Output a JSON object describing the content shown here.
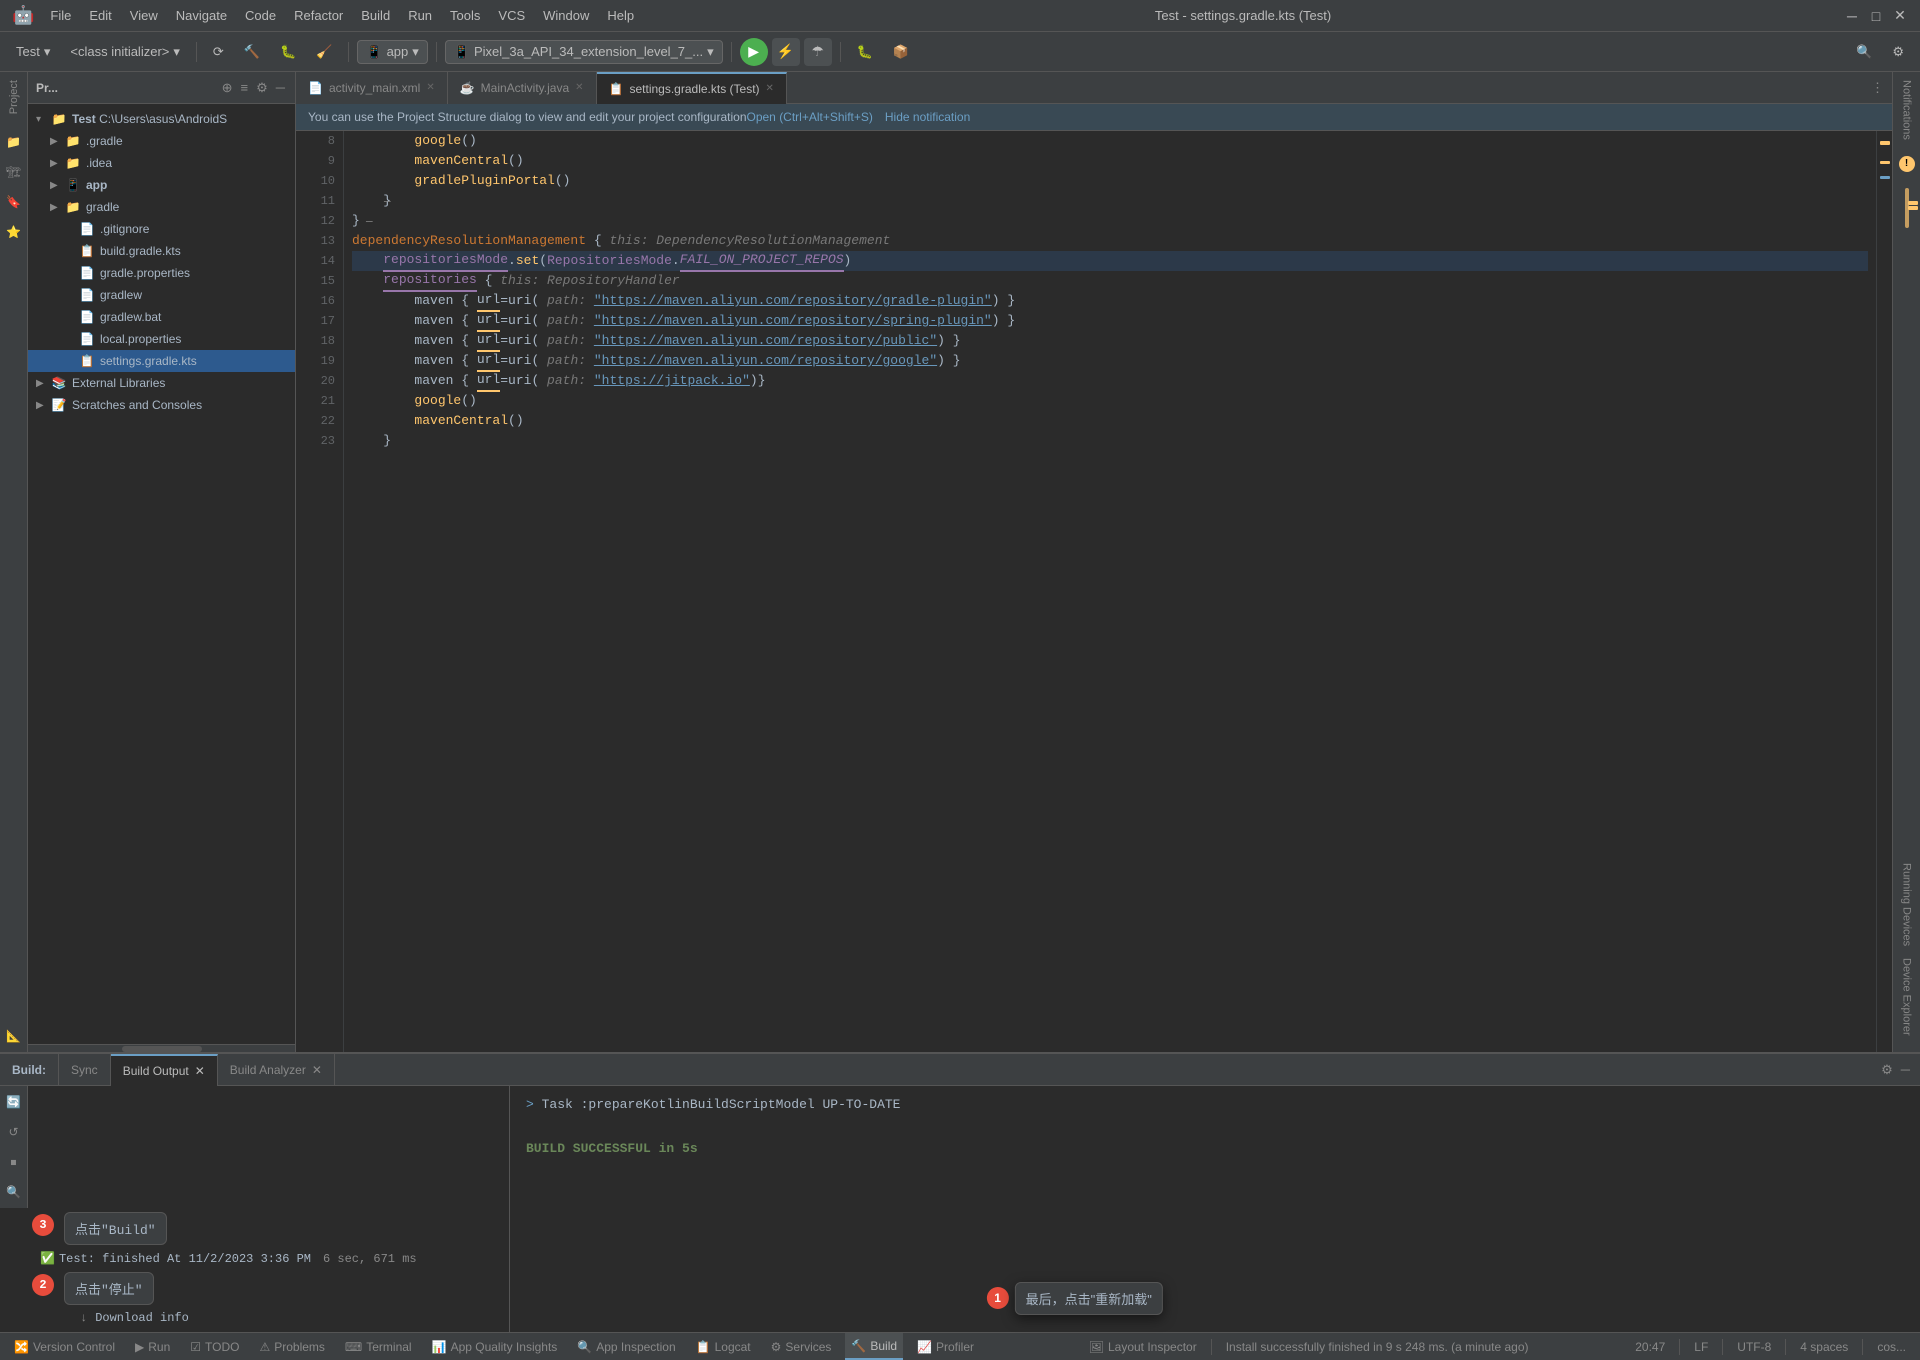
{
  "app": {
    "icon": "🤖",
    "title": "Test - settings.gradle.kts (Test)"
  },
  "menu": {
    "items": [
      "File",
      "Edit",
      "View",
      "Navigate",
      "Code",
      "Refactor",
      "Build",
      "Run",
      "Tools",
      "VCS",
      "Window",
      "Help"
    ]
  },
  "toolbar": {
    "project_label": "Test",
    "class_initializer": "<class initializer>",
    "app_dropdown": "app",
    "device_dropdown": "Pixel_3a_API_34_extension_level_7_...",
    "run_icon": "▶",
    "debug_icon": "🐛",
    "sync_icon": "🔄"
  },
  "tabs": {
    "items": [
      {
        "label": "activity_main.xml",
        "icon": "📄",
        "active": false
      },
      {
        "label": "MainActivity.java",
        "icon": "☕",
        "active": false
      },
      {
        "label": "settings.gradle.kts (Test)",
        "icon": "📋",
        "active": true
      }
    ]
  },
  "notification": {
    "text": "You can use the Project Structure dialog to view and edit your project configuration",
    "action1": "Open (Ctrl+Alt+Shift+S)",
    "action2": "Hide notification"
  },
  "project_panel": {
    "title": "Pr...",
    "items": [
      {
        "level": 0,
        "label": "Test",
        "path": "C:\\Users\\asus\\AndroidS",
        "icon": "📁",
        "expanded": true,
        "selected": false
      },
      {
        "level": 1,
        "label": ".gradle",
        "icon": "📁",
        "expanded": false,
        "selected": false
      },
      {
        "level": 1,
        "label": ".idea",
        "icon": "📁",
        "expanded": false,
        "selected": false
      },
      {
        "level": 1,
        "label": "app",
        "icon": "📱",
        "expanded": false,
        "selected": false
      },
      {
        "level": 1,
        "label": "gradle",
        "icon": "📁",
        "expanded": false,
        "selected": false
      },
      {
        "level": 1,
        "label": ".gitignore",
        "icon": "📄",
        "expanded": false,
        "selected": false
      },
      {
        "level": 1,
        "label": "build.gradle.kts",
        "icon": "📋",
        "expanded": false,
        "selected": false
      },
      {
        "level": 1,
        "label": "gradle.properties",
        "icon": "📄",
        "expanded": false,
        "selected": false
      },
      {
        "level": 1,
        "label": "gradlew",
        "icon": "📄",
        "expanded": false,
        "selected": false
      },
      {
        "level": 1,
        "label": "gradlew.bat",
        "icon": "📄",
        "expanded": false,
        "selected": false
      },
      {
        "level": 1,
        "label": "local.properties",
        "icon": "📄",
        "expanded": false,
        "selected": false
      },
      {
        "level": 1,
        "label": "settings.gradle.kts",
        "icon": "📋",
        "expanded": false,
        "selected": true
      },
      {
        "level": 0,
        "label": "External Libraries",
        "icon": "📚",
        "expanded": false,
        "selected": false
      },
      {
        "level": 0,
        "label": "Scratches and Consoles",
        "icon": "📝",
        "expanded": false,
        "selected": false
      }
    ]
  },
  "code": {
    "lines": [
      {
        "num": 8,
        "content": "        google()"
      },
      {
        "num": 9,
        "content": "        mavenCentral()"
      },
      {
        "num": 10,
        "content": "        gradlePluginPortal()"
      },
      {
        "num": 11,
        "content": "    }"
      },
      {
        "num": 12,
        "content": "}"
      },
      {
        "num": 13,
        "content": "dependencyResolutionManagement {",
        "hint": "this: DependencyResolutionManagement"
      },
      {
        "num": 14,
        "content": "    repositoriesMode.set(RepositoriesMode.FAIL_ON_PROJECT_REPOS)"
      },
      {
        "num": 15,
        "content": "    repositories {",
        "hint": "this: RepositoryHandler"
      },
      {
        "num": 16,
        "content": "        maven { url=uri( path: \"https://maven.aliyun.com/repository/gradle-plugin\") }"
      },
      {
        "num": 17,
        "content": "        maven { url=uri( path: \"https://maven.aliyun.com/repository/spring-plugin\") }"
      },
      {
        "num": 18,
        "content": "        maven { url=uri( path: \"https://maven.aliyun.com/repository/public\") }"
      },
      {
        "num": 19,
        "content": "        maven { url=uri( path: \"https://maven.aliyun.com/repository/google\") }"
      },
      {
        "num": 20,
        "content": "        maven { url=uri( path: \"https://jitpack.io\")}",
        "bulb": true
      },
      {
        "num": 21,
        "content": "        google()"
      },
      {
        "num": 22,
        "content": "        mavenCentral()"
      },
      {
        "num": 23,
        "content": "    }"
      }
    ]
  },
  "bottom_panel": {
    "tabs": [
      {
        "label": "Build:",
        "active": false
      },
      {
        "label": "Sync",
        "active": false
      },
      {
        "label": "Build Output",
        "active": true,
        "closeable": true
      },
      {
        "label": "Build Analyzer",
        "active": false,
        "closeable": true
      }
    ],
    "build_tree": [
      {
        "label": "Test: finished At 11/2/2023 3:36 PM",
        "time": "6 sec, 671 ms",
        "icon": "✅"
      },
      {
        "label": "Download info",
        "icon": "↓",
        "indent": 1
      }
    ],
    "output": [
      "> Task :prepareKotlinBuildScriptModel UP-TO-DATE",
      "",
      "BUILD SUCCESSFUL in 5s"
    ]
  },
  "status_bar": {
    "items": [
      {
        "label": "Version Control",
        "icon": "🔀"
      },
      {
        "label": "Run",
        "icon": "▶"
      },
      {
        "label": "TODO",
        "icon": "☑"
      },
      {
        "label": "Problems",
        "icon": "⚠"
      },
      {
        "label": "Terminal",
        "icon": "⌨"
      },
      {
        "label": "App Quality Insights",
        "icon": "📊"
      },
      {
        "label": "App Inspection",
        "icon": "🔍"
      },
      {
        "label": "Logcat",
        "icon": "📋"
      },
      {
        "label": "Services",
        "icon": "⚙"
      },
      {
        "label": "Build",
        "icon": "🔨",
        "active": true
      },
      {
        "label": "Profiler",
        "icon": "📈"
      },
      {
        "label": "Layout Inspector",
        "icon": "🖼"
      }
    ],
    "right_info": {
      "line_col": "20:47",
      "line_sep": "LF",
      "encoding": "UTF-8",
      "indent": "4 spaces",
      "context": "cos..."
    }
  },
  "step_indicators": [
    {
      "num": "1",
      "label": "点击\"Build\"",
      "pos": "bottom-right"
    },
    {
      "num": "2",
      "label": "点击\"停止\"",
      "pos": "build-left"
    },
    {
      "num": "3",
      "label": "最后，点击\"重新加载\"",
      "pos": "build-top"
    }
  ],
  "right_panel_labels": {
    "notifications": "Notifications",
    "running_devices": "Running Devices",
    "device_explorer": "Device Explorer"
  }
}
